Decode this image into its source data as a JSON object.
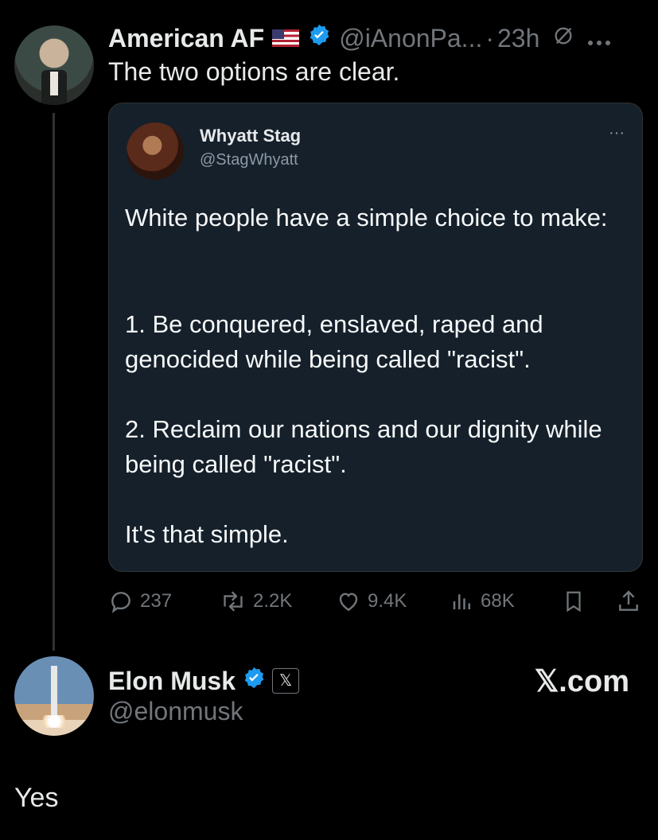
{
  "main_tweet": {
    "display_name": "American AF",
    "flag_icon": "us-flag-icon",
    "handle": "@iAnonPa...",
    "dot": "·",
    "time": "23h",
    "text": "The two options are clear."
  },
  "quoted_tweet": {
    "display_name": "Whyatt Stag",
    "handle": "@StagWhyatt",
    "more": "···",
    "paragraphs": [
      "White people have a simple choice to make:",
      "1. Be conquered, enslaved, raped and genocided while being called \"racist\".",
      "2. Reclaim our nations and our dignity while being called \"racist\".",
      "It's that simple."
    ]
  },
  "actions": {
    "replies": "237",
    "reposts": "2.2K",
    "likes": "9.4K",
    "views": "68K"
  },
  "reply": {
    "display_name": "Elon Musk",
    "handle": "@elonmusk",
    "badge_label": "𝕏",
    "brand": "𝕏.com",
    "text": "Yes"
  },
  "colors": {
    "background": "#000000",
    "verified_blue": "#1d9bf0",
    "muted": "#71767b",
    "quote_bg": "#15202b"
  }
}
